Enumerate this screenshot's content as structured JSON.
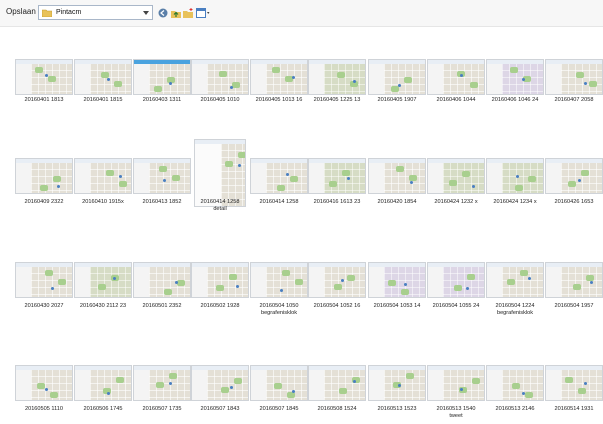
{
  "toolbar": {
    "save_in_label": "Opslaan in:",
    "folder_name": "Pintacm"
  },
  "files": [
    {
      "line1": "20160401 1813",
      "line2": ""
    },
    {
      "line1": "20160401 1815",
      "line2": ""
    },
    {
      "line1": "20160403 1311",
      "line2": ""
    },
    {
      "line1": "20160405 1010",
      "line2": ""
    },
    {
      "line1": "20160405 1013 16",
      "line2": ""
    },
    {
      "line1": "20160405 1225 13",
      "line2": ""
    },
    {
      "line1": "20160405 1907",
      "line2": ""
    },
    {
      "line1": "20160406 1044",
      "line2": ""
    },
    {
      "line1": "20160406 1046 24",
      "line2": ""
    },
    {
      "line1": "20160407 2058",
      "line2": ""
    },
    {
      "line1": "20160409 2322",
      "line2": ""
    },
    {
      "line1": "20160410 1915x",
      "line2": ""
    },
    {
      "line1": "20160413 1852",
      "line2": ""
    },
    {
      "line1": "20160414 1258",
      "line2": "detail"
    },
    {
      "line1": "20160414 1258",
      "line2": ""
    },
    {
      "line1": "20160416 1613 23",
      "line2": ""
    },
    {
      "line1": "20160420 1854",
      "line2": ""
    },
    {
      "line1": "20160424 1232 x",
      "line2": ""
    },
    {
      "line1": "20160424 1234 x",
      "line2": ""
    },
    {
      "line1": "20160426 1653",
      "line2": ""
    },
    {
      "line1": "20160430 2027",
      "line2": ""
    },
    {
      "line1": "20160430 2112 23",
      "line2": ""
    },
    {
      "line1": "20160501 2352",
      "line2": ""
    },
    {
      "line1": "20160502 1928",
      "line2": ""
    },
    {
      "line1": "20160504 1050",
      "line2": "begrafenisklok"
    },
    {
      "line1": "20160504 1052 16",
      "line2": ""
    },
    {
      "line1": "20160504 1053 14",
      "line2": ""
    },
    {
      "line1": "20160504 1055 24",
      "line2": ""
    },
    {
      "line1": "20160504 1224",
      "line2": "begrafenisklok"
    },
    {
      "line1": "20160504 1957",
      "line2": ""
    },
    {
      "line1": "20160505 1110",
      "line2": ""
    },
    {
      "line1": "20160506 1745",
      "line2": ""
    },
    {
      "line1": "20160507 1735",
      "line2": ""
    },
    {
      "line1": "20160507 1843",
      "line2": ""
    },
    {
      "line1": "20160507 1845",
      "line2": ""
    },
    {
      "line1": "20160508 1524",
      "line2": ""
    },
    {
      "line1": "20160513 1523",
      "line2": ""
    },
    {
      "line1": "20160513 1540",
      "line2": "tweet"
    },
    {
      "line1": "20160513 2146",
      "line2": ""
    },
    {
      "line1": "20160514 1931",
      "line2": ""
    }
  ]
}
